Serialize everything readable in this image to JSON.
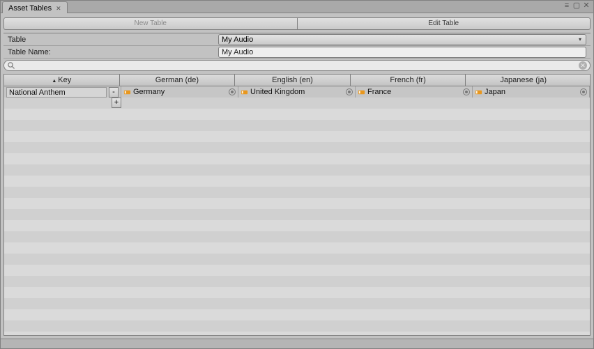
{
  "tab": {
    "title": "Asset Tables"
  },
  "modes": {
    "new": "New Table",
    "edit": "Edit Table"
  },
  "fields": {
    "table_label": "Table",
    "table_value": "My Audio",
    "tablename_label": "Table Name:",
    "tablename_value": "My Audio"
  },
  "search": {
    "placeholder": ""
  },
  "columns": {
    "key": "Key",
    "locales": [
      "German (de)",
      "English (en)",
      "French (fr)",
      "Japanese (ja)"
    ]
  },
  "rows": [
    {
      "key": "National Anthem",
      "values": [
        "Germany",
        "United Kingdom",
        "France",
        "Japan"
      ]
    }
  ],
  "buttons": {
    "remove": "-",
    "add": "+"
  }
}
